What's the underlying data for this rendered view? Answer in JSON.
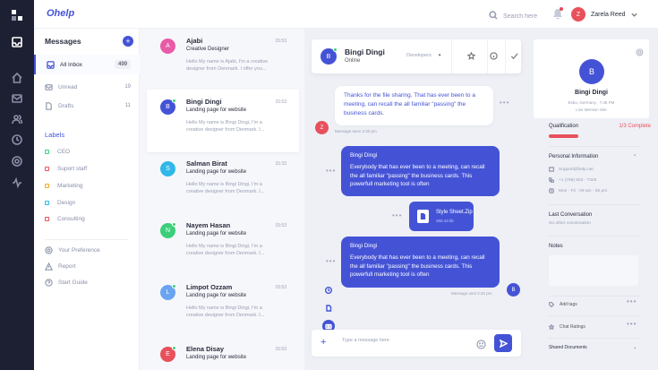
{
  "app": {
    "logo_text": "Ohelp"
  },
  "topbar": {
    "search_placeholder": "Search here",
    "user": {
      "initial": "Z",
      "name": "Zarela Reed",
      "avatar_color": "#e8505b"
    }
  },
  "colors": {
    "accent": "#4453d6",
    "rail": "#1d2033",
    "danger": "#e8505b",
    "online": "#3ccf7a"
  },
  "rail_icons": [
    "logo-icon",
    "inbox-icon",
    "home-icon",
    "mail-icon",
    "users-icon",
    "clock-icon",
    "settings-icon",
    "activity-icon"
  ],
  "menu": {
    "title": "Messages",
    "folders": [
      {
        "label": "All Inbox",
        "count": "499",
        "icon": "inbox-icon"
      },
      {
        "label": "Unread",
        "count": "19",
        "icon": "mail-icon"
      },
      {
        "label": "Drafts",
        "count": "11",
        "icon": "draft-icon"
      }
    ],
    "labels_title": "Labels",
    "labels": [
      {
        "label": "CEO",
        "color": "#3ccf7a"
      },
      {
        "label": "Suport staff",
        "color": "#e8505b"
      },
      {
        "label": "Marketing",
        "color": "#f5a623"
      },
      {
        "label": "Design",
        "color": "#2fb8e8"
      },
      {
        "label": "Consulting",
        "color": "#e8505b"
      }
    ],
    "extras": [
      {
        "label": "Your Preference",
        "icon": "settings-icon"
      },
      {
        "label": "Report",
        "icon": "warning-icon"
      },
      {
        "label": "Start Guide",
        "icon": "help-icon"
      }
    ]
  },
  "conversations": [
    {
      "initial": "A",
      "color": "#e85ba6",
      "name": "Ajabi",
      "subject": "Creative Designer",
      "time": "15:53",
      "preview": "Hello My name is Ajabi, I'm a creative designer from Denmark. I offer you...",
      "online": false
    },
    {
      "initial": "B",
      "color": "#4453d6",
      "name": "Bingi Dingi",
      "subject": "Landing page for website",
      "time": "15:53",
      "preview": "Hello My name is Bingi Dingi, I'm a creative designer from Denmark. I...",
      "online": true
    },
    {
      "initial": "S",
      "color": "#2fb8e8",
      "name": "Salman Birat",
      "subject": "Landing page for website",
      "time": "15:33",
      "preview": "Hello My name is Bingi Dingi, I'm a creative designer from Denmark. I...",
      "online": false
    },
    {
      "initial": "N",
      "color": "#3ccf7a",
      "name": "Nayem Hasan",
      "subject": "Landing page for website",
      "time": "15:53",
      "preview": "Hello My name is Bingi Dingi, I'm a creative designer from Denmark. I...",
      "online": true
    },
    {
      "initial": "L",
      "color": "#6aa4f0",
      "name": "Limpot Ozzam",
      "subject": "Landing page for website",
      "time": "15:53",
      "preview": "Hello My name is Bingi Dingi, I'm a creative designer from Denmark. I...",
      "online": true
    },
    {
      "initial": "E",
      "color": "#e8505b",
      "name": "Elena Disay",
      "subject": "Landing page for website",
      "time": "15:53",
      "preview": "",
      "online": true
    }
  ],
  "chat": {
    "contact": {
      "initial": "B",
      "name": "Bingi Dingi",
      "status": "Online"
    },
    "department": "Developers",
    "incoming": {
      "text": "Thanks for the file sharing. That has ever been to a meeting, can recall the all familiar \"passing\" the business cards.",
      "meta": "Message seen 2:30 pm",
      "initial": "Z"
    },
    "outgoing_1": {
      "name": "Bingi Dingi",
      "text": "Everybody that has ever been to a meeting, can recall the all familiar \"passing\" the business cards. This powerfull marketing tool is often"
    },
    "file": {
      "name": "Style Sheet.Zip",
      "size": "250.43 kb"
    },
    "outgoing_2": {
      "name": "Bingi Dingi",
      "text": "Everybody that has ever been to a meeting, can recall the all familiar \"passing\" the business cards. This powerfull marketing tool is often",
      "meta": "Message sent 2:40 pm",
      "initial": "B"
    },
    "composer_placeholder": "Type a message here"
  },
  "profile": {
    "initial": "B",
    "name": "Bingi Dingi",
    "location": "Esbo, Germany , 7:46 PM",
    "link": "Live Mention Site",
    "qualification_label": "Qualification",
    "qualification_value": "1/3 Complete",
    "qualification_fraction": 0.33,
    "personal_info_title": "Personal Information",
    "email": "Support@help.net",
    "phone": "+1 (786) 503 - 7328",
    "hours": "Mon - Fri : 09 am - 06 pm",
    "last_conversation_title": "Last Conversation",
    "last_conversation_value": "No other conversation",
    "notes_title": "Notes",
    "actions": [
      {
        "label": "Add tags",
        "icon": "tag-icon"
      },
      {
        "label": "Chat Ratings",
        "icon": "star-icon"
      }
    ],
    "shared_docs_title": "Shared Documents"
  }
}
